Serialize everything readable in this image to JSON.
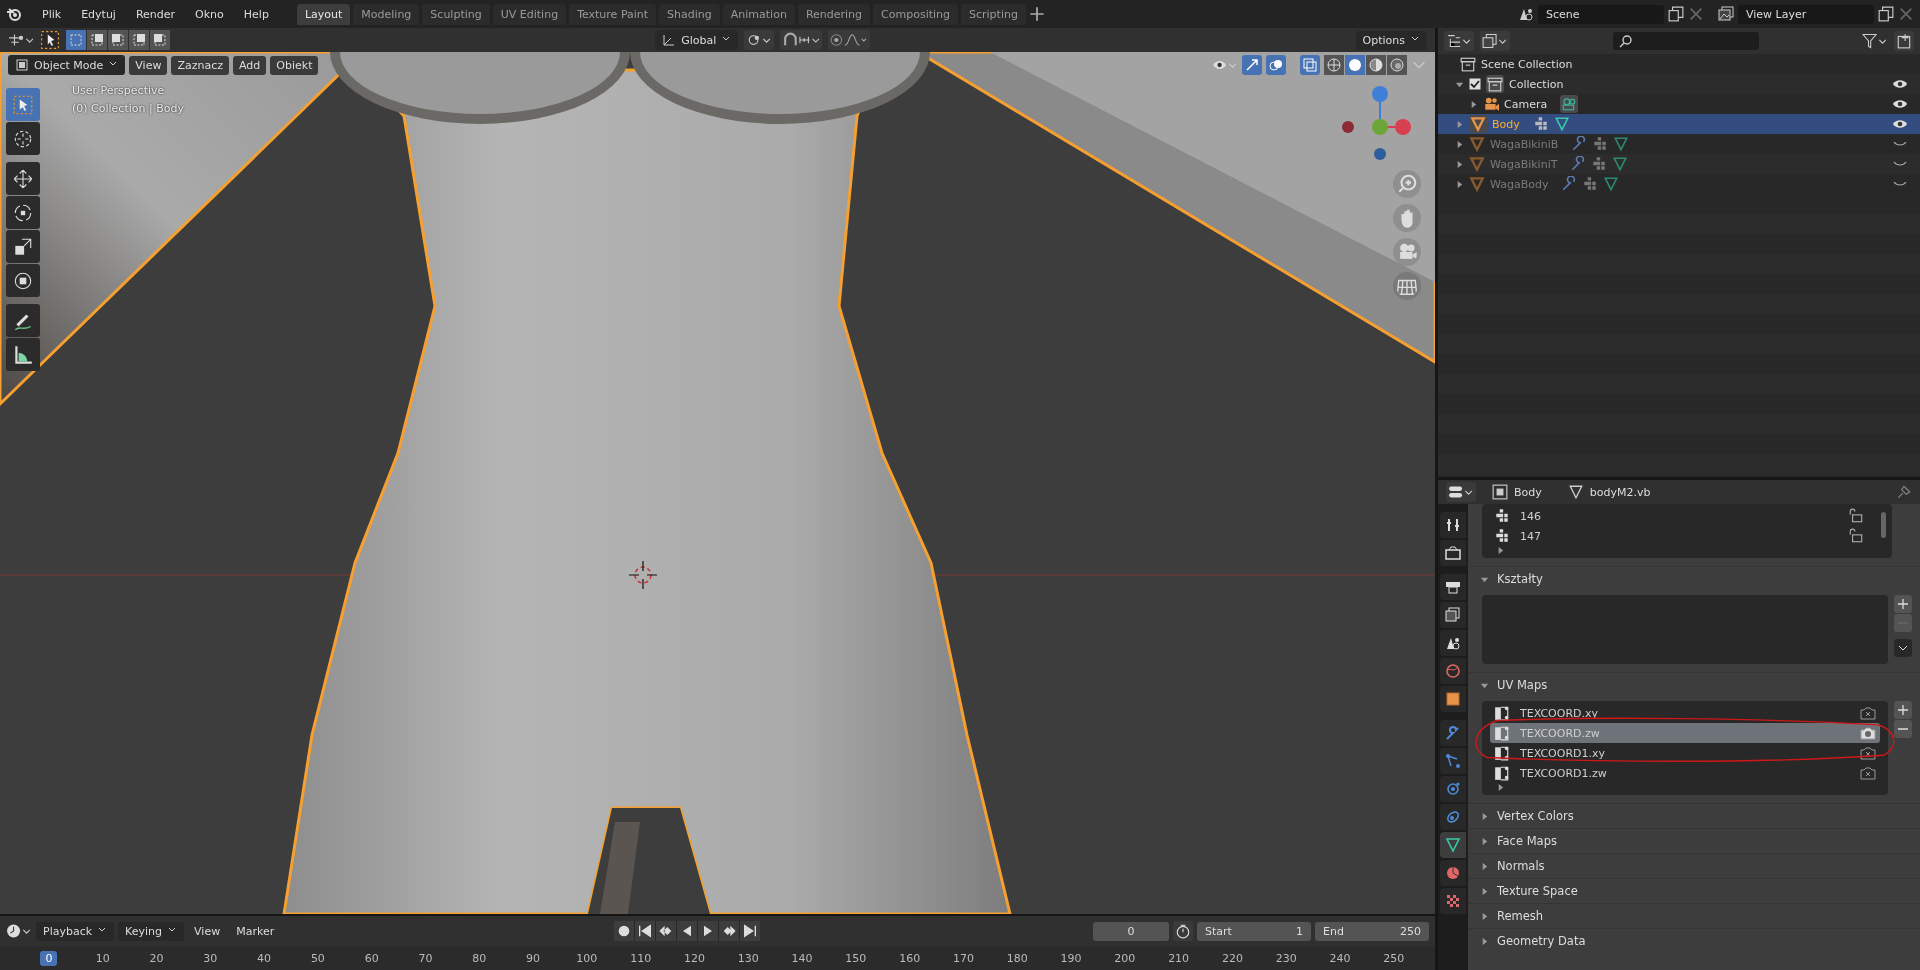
{
  "menu": [
    "Plik",
    "Edytuj",
    "Render",
    "Okno",
    "Help"
  ],
  "workspaces": [
    {
      "label": "Layout",
      "selected": true
    },
    {
      "label": "Modeling",
      "selected": false
    },
    {
      "label": "Sculpting",
      "selected": false
    },
    {
      "label": "UV Editing",
      "selected": false
    },
    {
      "label": "Texture Paint",
      "selected": false
    },
    {
      "label": "Shading",
      "selected": false
    },
    {
      "label": "Animation",
      "selected": false
    },
    {
      "label": "Rendering",
      "selected": false
    },
    {
      "label": "Compositing",
      "selected": false
    },
    {
      "label": "Scripting",
      "selected": false
    }
  ],
  "scene": "Scene",
  "view_layer": "View Layer",
  "select_modes": [
    {
      "selected": true
    },
    {
      "selected": false
    },
    {
      "selected": false
    },
    {
      "selected": false
    },
    {
      "selected": false
    }
  ],
  "orientation": "Global",
  "options": "Options",
  "mode": "Object Mode",
  "view_menus": [
    "View",
    "Zaznacz",
    "Add",
    "Obiekt"
  ],
  "overlay_text": [
    "User Perspective",
    "(0) Collection | Body"
  ],
  "shading": [
    {
      "kind": "wire",
      "selected": false
    },
    {
      "kind": "solid",
      "selected": true
    },
    {
      "kind": "material",
      "selected": false
    },
    {
      "kind": "rendered",
      "selected": false
    }
  ],
  "tools": [
    {
      "kind": "select",
      "selected": true
    },
    {
      "kind": "cursor",
      "selected": false
    },
    {
      "kind": "move",
      "selected": false
    },
    {
      "kind": "rotate",
      "selected": false
    },
    {
      "kind": "scale",
      "selected": false
    },
    {
      "kind": "transform",
      "selected": false
    },
    {
      "kind": "annotate",
      "selected": false
    },
    {
      "kind": "measure",
      "selected": false
    }
  ],
  "outliner": {
    "root": "Scene Collection",
    "items": [
      {
        "name": "Collection",
        "kind": "collection",
        "checked": true,
        "selected": false,
        "hidden": false,
        "modifier": false,
        "children": [
          {
            "name": "Camera",
            "kind": "camera",
            "selected": false,
            "hidden": false,
            "modifier": false
          }
        ]
      },
      {
        "name": "Body",
        "kind": "mesh",
        "selected": true,
        "hidden": false,
        "modifier": false
      },
      {
        "name": "WagaBikiniB",
        "kind": "mesh",
        "selected": false,
        "hidden": true,
        "modifier": true
      },
      {
        "name": "WagaBikiniT",
        "kind": "mesh",
        "selected": false,
        "hidden": true,
        "modifier": true
      },
      {
        "name": "WagaBody",
        "kind": "mesh",
        "selected": false,
        "hidden": true,
        "modifier": true
      }
    ]
  },
  "properties": {
    "object": "Body",
    "mesh": "bodyM2.vb",
    "tabs": [
      {
        "kind": "tool",
        "selected": false
      },
      {
        "kind": "render",
        "selected": false
      },
      {
        "kind": "output",
        "selected": false
      },
      {
        "kind": "view_layer",
        "selected": false
      },
      {
        "kind": "scene",
        "selected": false
      },
      {
        "kind": "world",
        "selected": false
      },
      {
        "kind": "object",
        "selected": false
      },
      {
        "kind": "modifiers",
        "selected": false
      },
      {
        "kind": "particles",
        "selected": false
      },
      {
        "kind": "physics",
        "selected": false
      },
      {
        "kind": "constraints",
        "selected": false
      },
      {
        "kind": "data",
        "selected": true
      },
      {
        "kind": "material",
        "selected": false
      },
      {
        "kind": "texture",
        "selected": false
      }
    ],
    "vertex_groups": [
      "146",
      "147"
    ],
    "panels": [
      {
        "title": "Kształty",
        "kind": "shape_keys",
        "expanded": true
      },
      {
        "title": "UV Maps",
        "kind": "uv_maps",
        "expanded": true,
        "items": [
          {
            "name": "TEXCOORD.xy",
            "selected": false,
            "active_render": false
          },
          {
            "name": "TEXCOORD.zw",
            "selected": true,
            "active_render": true
          },
          {
            "name": "TEXCOORD1.xy",
            "selected": false,
            "active_render": false
          },
          {
            "name": "TEXCOORD1.zw",
            "selected": false,
            "active_render": false
          }
        ]
      },
      {
        "title": "Vertex Colors",
        "expanded": false
      },
      {
        "title": "Face Maps",
        "expanded": false
      },
      {
        "title": "Normals",
        "expanded": false
      },
      {
        "title": "Texture Space",
        "expanded": false
      },
      {
        "title": "Remesh",
        "expanded": false
      },
      {
        "title": "Geometry Data",
        "expanded": false
      }
    ]
  },
  "timeline": {
    "menus": [
      "Playback",
      "Keying",
      "View",
      "Marker"
    ],
    "current": "0",
    "start_label": "Start",
    "start": "1",
    "end_label": "End",
    "end": "250",
    "ruler": [
      {
        "label": "0",
        "selected": true
      },
      {
        "label": "10",
        "selected": false
      },
      {
        "label": "20",
        "selected": false
      },
      {
        "label": "30",
        "selected": false
      },
      {
        "label": "40",
        "selected": false
      },
      {
        "label": "50",
        "selected": false
      },
      {
        "label": "60",
        "selected": false
      },
      {
        "label": "70",
        "selected": false
      },
      {
        "label": "80",
        "selected": false
      },
      {
        "label": "90",
        "selected": false
      },
      {
        "label": "100",
        "selected": false
      },
      {
        "label": "110",
        "selected": false
      },
      {
        "label": "120",
        "selected": false
      },
      {
        "label": "130",
        "selected": false
      },
      {
        "label": "140",
        "selected": false
      },
      {
        "label": "150",
        "selected": false
      },
      {
        "label": "160",
        "selected": false
      },
      {
        "label": "170",
        "selected": false
      },
      {
        "label": "180",
        "selected": false
      },
      {
        "label": "190",
        "selected": false
      },
      {
        "label": "200",
        "selected": false
      },
      {
        "label": "210",
        "selected": false
      },
      {
        "label": "220",
        "selected": false
      },
      {
        "label": "230",
        "selected": false
      },
      {
        "label": "240",
        "selected": false
      },
      {
        "label": "250",
        "selected": false
      }
    ]
  }
}
